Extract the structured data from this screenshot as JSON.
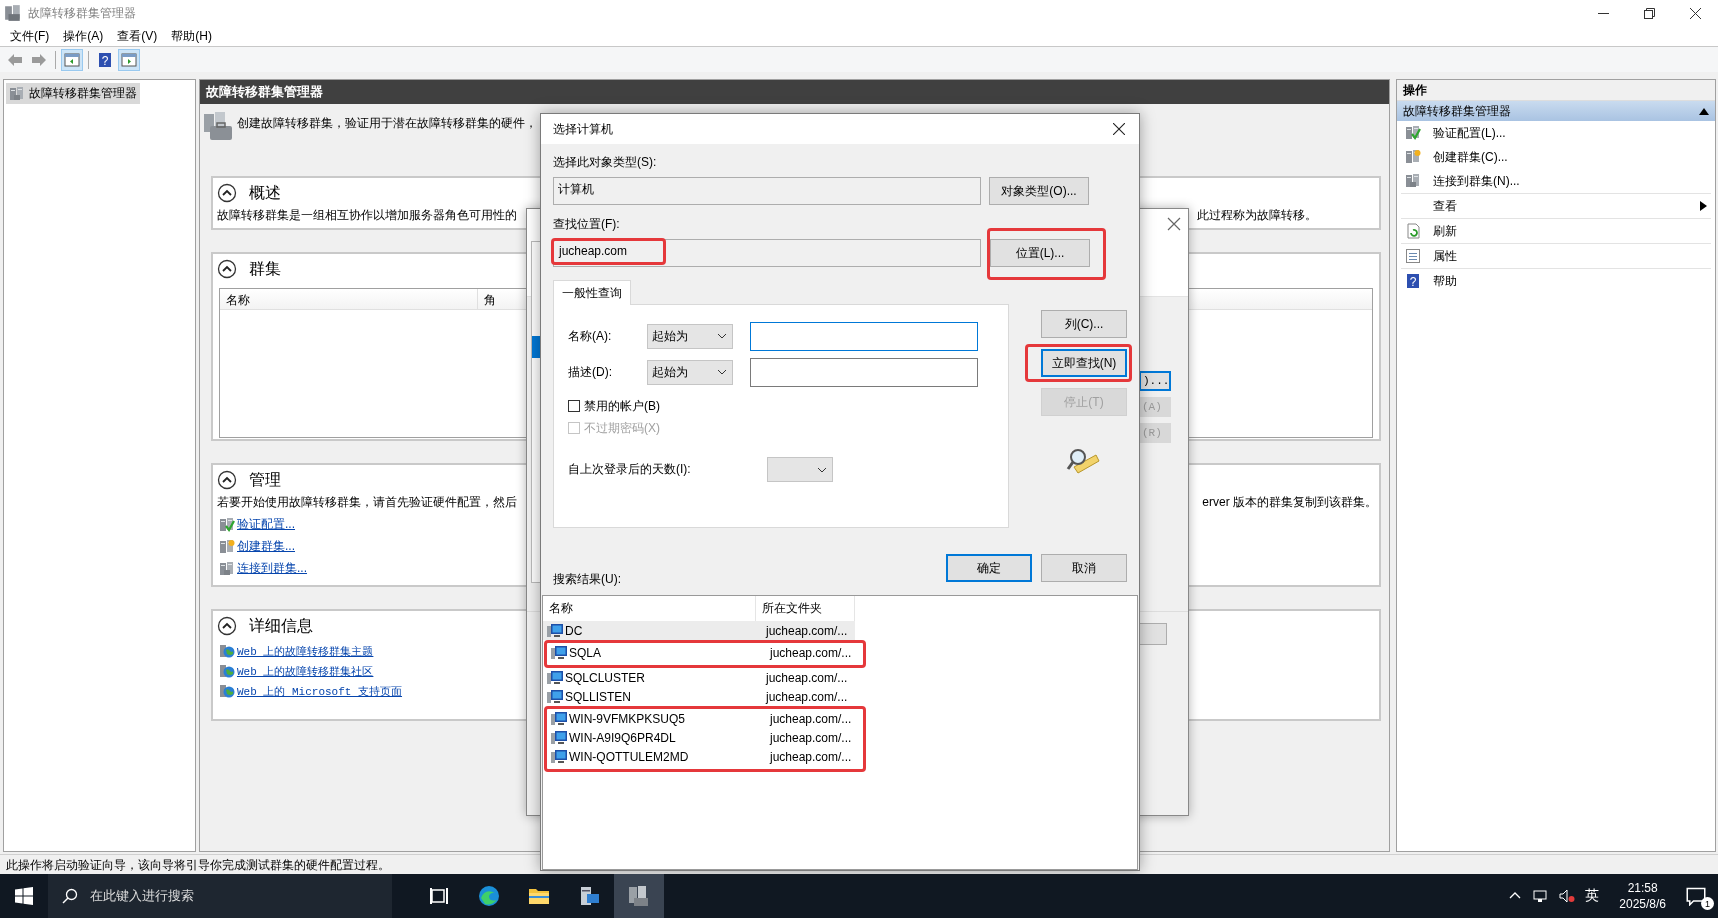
{
  "window": {
    "title": "故障转移群集管理器"
  },
  "menu": [
    "文件(F)",
    "操作(A)",
    "查看(V)",
    "帮助(H)"
  ],
  "toolbar": [
    {
      "kind": "back",
      "pressed": false
    },
    {
      "kind": "forward",
      "pressed": false
    },
    {
      "kind": "console-tree",
      "pressed": true
    },
    {
      "kind": "help",
      "pressed": false,
      "glyph": "?"
    },
    {
      "kind": "action-pane",
      "pressed": true
    }
  ],
  "tree": [
    {
      "label": "故障转移群集管理器",
      "selected": true
    }
  ],
  "center": {
    "header": "故障转移群集管理器",
    "intro": "创建故障转移群集，验证用于潜在故障转移群集的硬件，",
    "sections": [
      {
        "kind": "overview",
        "title": "概述",
        "expanded": true,
        "text_left": "故障转移群集是一组相互协作以增加服务器角色可用性的",
        "text_right": "此过程称为故障转移。"
      },
      {
        "kind": "table",
        "title": "群集",
        "expanded": true,
        "columns": [
          "名称",
          "角"
        ]
      },
      {
        "kind": "manage",
        "title": "管理",
        "expanded": true,
        "text_left": "若要开始使用故障转移群集，请首先验证硬件配置，然后",
        "text_right": "erver 版本的群集复制到该群集。",
        "links": [
          {
            "kind": "validate",
            "label": "验证配置..."
          },
          {
            "kind": "create",
            "label": "创建群集..."
          },
          {
            "kind": "connect",
            "label": "连接到群集..."
          }
        ]
      },
      {
        "kind": "details",
        "title": "详细信息",
        "expanded": true,
        "links": [
          {
            "kind": "web",
            "label": "Web 上的故障转移群集主题"
          },
          {
            "kind": "web",
            "label": "Web 上的故障转移群集社区"
          },
          {
            "kind": "web",
            "label": "Web 上的 Microsoft 支持页面"
          }
        ]
      }
    ]
  },
  "actions": {
    "title": "操作",
    "group": {
      "label": "故障转移群集管理器",
      "expanded": true
    },
    "items": [
      {
        "kind": "validate",
        "label": "验证配置(L)..."
      },
      {
        "kind": "create",
        "label": "创建群集(C)..."
      },
      {
        "kind": "connect",
        "label": "连接到群集(N)..."
      },
      {
        "kind": "submenu",
        "label": "查看"
      },
      {
        "kind": "refresh",
        "label": "刷新"
      },
      {
        "kind": "properties",
        "label": "属性"
      },
      {
        "kind": "help",
        "label": "帮助",
        "glyph": "?"
      }
    ]
  },
  "wizard": {
    "buttons": [
      {
        "label": ")...",
        "kind": "default"
      },
      {
        "label": "(A)",
        "kind": "disabled"
      },
      {
        "label": "(R)",
        "kind": "disabled"
      }
    ]
  },
  "dialog": {
    "title": "选择计算机",
    "type_label": "选择此对象类型(S):",
    "type_value": "计算机",
    "type_button": "对象类型(O)...",
    "location_label": "查找位置(F):",
    "location_value": "jucheap.com",
    "location_highlighted": true,
    "location_button": {
      "label": "位置(L)...",
      "highlighted": true
    },
    "tab": {
      "label": "一般性查询",
      "selected": true
    },
    "query_rows": [
      {
        "label": "名称(A):",
        "operator": "起始为",
        "focused": true
      },
      {
        "label": "描述(D):",
        "operator": "起始为",
        "focused": false
      }
    ],
    "checkboxes": [
      {
        "label": "禁用的帐户(B)",
        "checked": false,
        "disabled": false
      },
      {
        "label": "不过期密码(X)",
        "checked": false,
        "disabled": true
      }
    ],
    "days_label": "自上次登录后的天数(I):",
    "side_buttons": [
      {
        "label": "列(C)...",
        "kind": "normal",
        "highlighted": false
      },
      {
        "label": "立即查找(N)",
        "kind": "default",
        "highlighted": true
      },
      {
        "label": "停止(T)",
        "kind": "disabled",
        "highlighted": false
      }
    ],
    "ok": "确定",
    "cancel": "取消",
    "results_label": "搜索结果(U):",
    "results": {
      "columns": [
        "名称",
        "所在文件夹"
      ],
      "rows": [
        {
          "name": "DC",
          "folder": "jucheap.com/...",
          "selected": true,
          "highlighted": false
        },
        {
          "name": "SQLA",
          "folder": "jucheap.com/...",
          "selected": false,
          "highlighted": true
        },
        {
          "name": "SQLCLUSTER",
          "folder": "jucheap.com/...",
          "selected": false,
          "highlighted": false
        },
        {
          "name": "SQLLISTEN",
          "folder": "jucheap.com/...",
          "selected": false,
          "highlighted": false
        },
        {
          "name": "WIN-9VFMKPKSUQ5",
          "folder": "jucheap.com/...",
          "selected": false,
          "highlighted": true
        },
        {
          "name": "WIN-A9I9Q6PR4DL",
          "folder": "jucheap.com/...",
          "selected": false,
          "highlighted": true
        },
        {
          "name": "WIN-QOTTULEM2MD",
          "folder": "jucheap.com/...",
          "selected": false,
          "highlighted": true
        }
      ]
    }
  },
  "status_bar": "此操作将启动验证向导，该向导将引导你完成测试群集的硬件配置过程。",
  "taskbar": {
    "search_placeholder": "在此键入进行搜索",
    "apps": [
      {
        "kind": "task-view",
        "active": false
      },
      {
        "kind": "edge",
        "active": false
      },
      {
        "kind": "explorer",
        "active": false
      },
      {
        "kind": "server-manager",
        "active": false
      },
      {
        "kind": "cluster-manager",
        "active": true
      }
    ],
    "ime": "英",
    "time": "21:58",
    "date": "2025/8/6",
    "notifications": "1"
  }
}
